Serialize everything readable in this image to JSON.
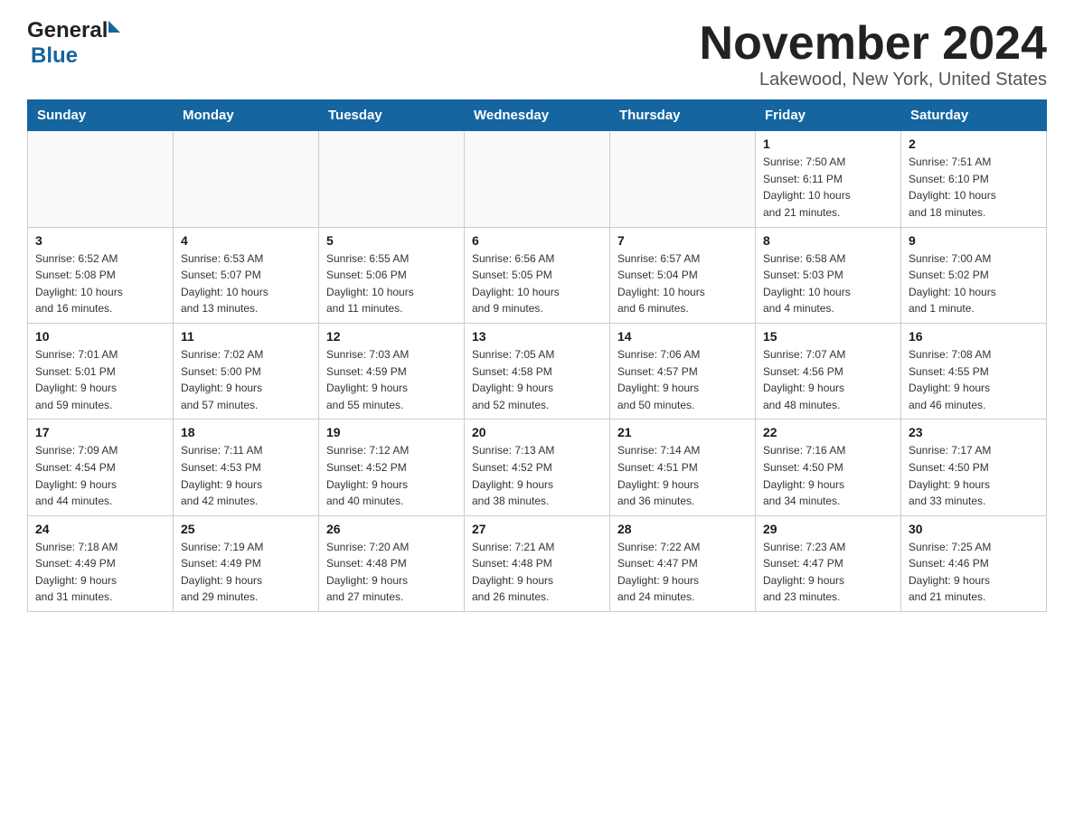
{
  "logo": {
    "general": "General",
    "blue": "Blue"
  },
  "title": "November 2024",
  "subtitle": "Lakewood, New York, United States",
  "days_of_week": [
    "Sunday",
    "Monday",
    "Tuesday",
    "Wednesday",
    "Thursday",
    "Friday",
    "Saturday"
  ],
  "weeks": [
    {
      "days": [
        {
          "number": "",
          "info": ""
        },
        {
          "number": "",
          "info": ""
        },
        {
          "number": "",
          "info": ""
        },
        {
          "number": "",
          "info": ""
        },
        {
          "number": "",
          "info": ""
        },
        {
          "number": "1",
          "info": "Sunrise: 7:50 AM\nSunset: 6:11 PM\nDaylight: 10 hours\nand 21 minutes."
        },
        {
          "number": "2",
          "info": "Sunrise: 7:51 AM\nSunset: 6:10 PM\nDaylight: 10 hours\nand 18 minutes."
        }
      ]
    },
    {
      "days": [
        {
          "number": "3",
          "info": "Sunrise: 6:52 AM\nSunset: 5:08 PM\nDaylight: 10 hours\nand 16 minutes."
        },
        {
          "number": "4",
          "info": "Sunrise: 6:53 AM\nSunset: 5:07 PM\nDaylight: 10 hours\nand 13 minutes."
        },
        {
          "number": "5",
          "info": "Sunrise: 6:55 AM\nSunset: 5:06 PM\nDaylight: 10 hours\nand 11 minutes."
        },
        {
          "number": "6",
          "info": "Sunrise: 6:56 AM\nSunset: 5:05 PM\nDaylight: 10 hours\nand 9 minutes."
        },
        {
          "number": "7",
          "info": "Sunrise: 6:57 AM\nSunset: 5:04 PM\nDaylight: 10 hours\nand 6 minutes."
        },
        {
          "number": "8",
          "info": "Sunrise: 6:58 AM\nSunset: 5:03 PM\nDaylight: 10 hours\nand 4 minutes."
        },
        {
          "number": "9",
          "info": "Sunrise: 7:00 AM\nSunset: 5:02 PM\nDaylight: 10 hours\nand 1 minute."
        }
      ]
    },
    {
      "days": [
        {
          "number": "10",
          "info": "Sunrise: 7:01 AM\nSunset: 5:01 PM\nDaylight: 9 hours\nand 59 minutes."
        },
        {
          "number": "11",
          "info": "Sunrise: 7:02 AM\nSunset: 5:00 PM\nDaylight: 9 hours\nand 57 minutes."
        },
        {
          "number": "12",
          "info": "Sunrise: 7:03 AM\nSunset: 4:59 PM\nDaylight: 9 hours\nand 55 minutes."
        },
        {
          "number": "13",
          "info": "Sunrise: 7:05 AM\nSunset: 4:58 PM\nDaylight: 9 hours\nand 52 minutes."
        },
        {
          "number": "14",
          "info": "Sunrise: 7:06 AM\nSunset: 4:57 PM\nDaylight: 9 hours\nand 50 minutes."
        },
        {
          "number": "15",
          "info": "Sunrise: 7:07 AM\nSunset: 4:56 PM\nDaylight: 9 hours\nand 48 minutes."
        },
        {
          "number": "16",
          "info": "Sunrise: 7:08 AM\nSunset: 4:55 PM\nDaylight: 9 hours\nand 46 minutes."
        }
      ]
    },
    {
      "days": [
        {
          "number": "17",
          "info": "Sunrise: 7:09 AM\nSunset: 4:54 PM\nDaylight: 9 hours\nand 44 minutes."
        },
        {
          "number": "18",
          "info": "Sunrise: 7:11 AM\nSunset: 4:53 PM\nDaylight: 9 hours\nand 42 minutes."
        },
        {
          "number": "19",
          "info": "Sunrise: 7:12 AM\nSunset: 4:52 PM\nDaylight: 9 hours\nand 40 minutes."
        },
        {
          "number": "20",
          "info": "Sunrise: 7:13 AM\nSunset: 4:52 PM\nDaylight: 9 hours\nand 38 minutes."
        },
        {
          "number": "21",
          "info": "Sunrise: 7:14 AM\nSunset: 4:51 PM\nDaylight: 9 hours\nand 36 minutes."
        },
        {
          "number": "22",
          "info": "Sunrise: 7:16 AM\nSunset: 4:50 PM\nDaylight: 9 hours\nand 34 minutes."
        },
        {
          "number": "23",
          "info": "Sunrise: 7:17 AM\nSunset: 4:50 PM\nDaylight: 9 hours\nand 33 minutes."
        }
      ]
    },
    {
      "days": [
        {
          "number": "24",
          "info": "Sunrise: 7:18 AM\nSunset: 4:49 PM\nDaylight: 9 hours\nand 31 minutes."
        },
        {
          "number": "25",
          "info": "Sunrise: 7:19 AM\nSunset: 4:49 PM\nDaylight: 9 hours\nand 29 minutes."
        },
        {
          "number": "26",
          "info": "Sunrise: 7:20 AM\nSunset: 4:48 PM\nDaylight: 9 hours\nand 27 minutes."
        },
        {
          "number": "27",
          "info": "Sunrise: 7:21 AM\nSunset: 4:48 PM\nDaylight: 9 hours\nand 26 minutes."
        },
        {
          "number": "28",
          "info": "Sunrise: 7:22 AM\nSunset: 4:47 PM\nDaylight: 9 hours\nand 24 minutes."
        },
        {
          "number": "29",
          "info": "Sunrise: 7:23 AM\nSunset: 4:47 PM\nDaylight: 9 hours\nand 23 minutes."
        },
        {
          "number": "30",
          "info": "Sunrise: 7:25 AM\nSunset: 4:46 PM\nDaylight: 9 hours\nand 21 minutes."
        }
      ]
    }
  ]
}
